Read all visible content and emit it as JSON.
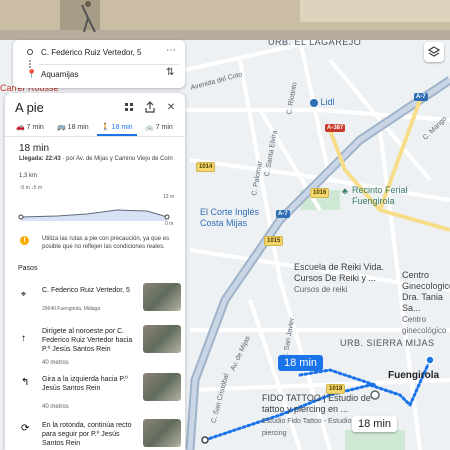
{
  "search": {
    "origin": "C. Federico Ruiz Vertedor, 5",
    "destination": "Aquamijas"
  },
  "panel": {
    "title": "A pie",
    "tabs": [
      {
        "icon": "car-icon",
        "label": "7 min"
      },
      {
        "icon": "bus-icon",
        "label": "18 min"
      },
      {
        "icon": "walk-icon",
        "label": "18 min",
        "active": true
      },
      {
        "icon": "bike-icon",
        "label": "7 min"
      }
    ],
    "duration": "18 min",
    "arrival_label": "Llegada: 22:43",
    "arrival_via": "· por Av. de Mijas y Camino Viejo de Coín",
    "distance": "1,3 km",
    "elevation_up": "5 m",
    "elevation_down": "5 m",
    "elevation_max": "12 m",
    "elevation_min": "0 m",
    "warning": "Utiliza las rutas a pie con precaución, ya que es posible que no reflejen las condiciones reales.",
    "steps_header": "Pasos",
    "steps": [
      {
        "icon": "pin-icon",
        "title": "C. Federico Ruiz Vertedor, 5",
        "subtitle": "29640 Fuengirola, Málaga"
      },
      {
        "icon": "arrow-up-icon",
        "title": "Dirígete al noroeste por C. Federico Ruiz Vertedor hacia P.º Jesús Santos Rein",
        "distance": "40 metros"
      },
      {
        "icon": "turn-left-icon",
        "title": "Gira a la izquierda hacia P.º Jesús Santos Rein",
        "distance": "40 metros"
      },
      {
        "icon": "roundabout-icon",
        "title": "En la rotonda, continúa recto para seguir por P.º Jesús Santos Rein"
      }
    ]
  },
  "map": {
    "areas": [
      "URB. EL LAGAREJO",
      "URB. SIERRA MIJAS"
    ],
    "streets": [
      "Carrer Rousse",
      "Avenida del Coto",
      "C. Riotinto",
      "C. Santa Elvira",
      "C. Palomar",
      "C. Mango",
      "C. San Javier",
      "C. San Cristóbal",
      "Av. de Mijas"
    ],
    "pois": [
      {
        "name": "Lidl",
        "icon": "cart-icon"
      },
      {
        "name": "Recinto Ferial Fuengirola",
        "icon": "park-icon"
      },
      {
        "name": "El Corte Inglés Costa Mijas",
        "icon": "store-icon"
      },
      {
        "name": "Escuela de Reiki Vida. Cursos De Reiki y ...",
        "sub": "Cursos de reiki"
      },
      {
        "name": "Centro Ginecologico Dra. Tania Sa...",
        "sub": "Centro ginecológico"
      },
      {
        "name": "FIDO TATTOO | Estudio de tattoo y piercing en ...",
        "sub": "Estudio Fido Tattoo - Estudio piercing"
      },
      {
        "name": "Fuengirola"
      }
    ],
    "road_badges": [
      "A-7",
      "A-387",
      "A-7",
      "1016",
      "1014",
      "1015",
      "1018"
    ],
    "route_labels": [
      "18 min",
      "18 min"
    ],
    "colors": {
      "route": "#1a73e8",
      "water": "#aad3df",
      "park": "#c8e6c9",
      "highway": "#8ab4f8"
    }
  }
}
